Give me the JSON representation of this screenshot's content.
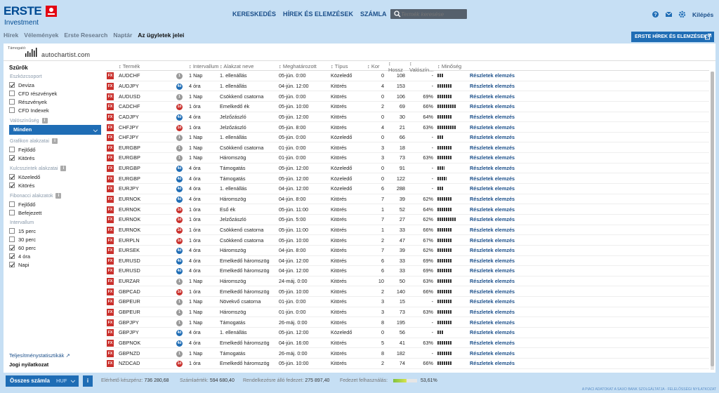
{
  "header": {
    "brand": "ERSTE",
    "sub": "Investment",
    "nav": [
      "KERESKEDÉS",
      "HÍREK ÉS ELEMZÉSEK",
      "SZÁMLA"
    ],
    "search_placeholder": "Termék keresése",
    "logout": "Kilépés"
  },
  "subnav": {
    "items": [
      "Hírek",
      "Vélemények",
      "Erste Research",
      "Naptár",
      "Az ügyletek jelei"
    ],
    "active": 4,
    "button": "ERSTE HÍREK ÉS ELEMZÉSEK"
  },
  "sponsor": {
    "label": "Támogató:",
    "name": "autochartist.com"
  },
  "filters": {
    "title": "Szűrők",
    "g1": "Eszközcsoport",
    "g1items": [
      {
        "l": "Deviza",
        "c": true
      },
      {
        "l": "CFD részvények",
        "c": false
      },
      {
        "l": "Részvények",
        "c": false
      },
      {
        "l": "CFD Indexek",
        "c": false
      }
    ],
    "g2": "Valószínűség",
    "select": "Minden",
    "g3": "Grafikon alakzatai",
    "g3items": [
      {
        "l": "Fejlődő",
        "c": false
      },
      {
        "l": "Kitörés",
        "c": true
      }
    ],
    "g4": "Kulcsszintek alakzatai",
    "g4items": [
      {
        "l": "Közeledő",
        "c": true
      },
      {
        "l": "Kitörés",
        "c": true
      }
    ],
    "g5": "Fibonacci alakzatok",
    "g5items": [
      {
        "l": "Fejlődő",
        "c": false
      },
      {
        "l": "Befejezett",
        "c": false
      }
    ],
    "g6": "Intervallum",
    "g6items": [
      {
        "l": "15 perc",
        "c": false
      },
      {
        "l": "30 perc",
        "c": false
      },
      {
        "l": "60 perc",
        "c": true
      },
      {
        "l": "4 óra",
        "c": true
      },
      {
        "l": "Napi",
        "c": true
      }
    ],
    "link1": "Teljesítménystatisztikák",
    "link2": "Jogi nyilatkozat"
  },
  "table": {
    "columns": [
      "Termék",
      "Intervallum",
      "Alakzat neve",
      "Meghatározott",
      "Típus",
      "Kor",
      "Hossz",
      "Valószín...",
      "Minőség",
      ""
    ],
    "link": "Részletek elemzés",
    "rows": [
      [
        "AUDCHF",
        "1 Nap",
        "1. ellenállás",
        "05-jún. 0:00",
        "Közeledő",
        "0",
        "108",
        "-",
        3
      ],
      [
        "AUDJPY",
        "4 óra",
        "1. ellenállás",
        "04-jún. 12:00",
        "Kitörés",
        "4",
        "153",
        "-",
        8
      ],
      [
        "AUDUSD",
        "1 Nap",
        "Csökkenő csatorna",
        "05-jún. 0:00",
        "Kitörés",
        "0",
        "106",
        "69%",
        8
      ],
      [
        "CADCHF",
        "1 óra",
        "Emelkedő ék",
        "05-jún. 10:00",
        "Kitörés",
        "2",
        "69",
        "66%",
        10
      ],
      [
        "CADJPY",
        "4 óra",
        "Jelzőzászló",
        "05-jún. 12:00",
        "Kitörés",
        "0",
        "30",
        "64%",
        8
      ],
      [
        "CHFJPY",
        "1 óra",
        "Jelzőzászló",
        "05-jún. 8:00",
        "Kitörés",
        "4",
        "21",
        "63%",
        10
      ],
      [
        "CHFJPY",
        "1 Nap",
        "1. ellenállás",
        "05-jún. 0:00",
        "Közeledő",
        "0",
        "66",
        "-",
        3
      ],
      [
        "EURGBP",
        "1 Nap",
        "Csökkenő csatorna",
        "01-jún. 0:00",
        "Kitörés",
        "3",
        "18",
        "-",
        8
      ],
      [
        "EURGBP",
        "1 Nap",
        "Háromszög",
        "01-jún. 0:00",
        "Kitörés",
        "3",
        "73",
        "63%",
        8
      ],
      [
        "EURGBP",
        "4 óra",
        "Támogatás",
        "05-jún. 12:00",
        "Közeledő",
        "0",
        "91",
        "-",
        4
      ],
      [
        "EURGBP",
        "4 óra",
        "Támogatás",
        "05-jún. 12:00",
        "Közeledő",
        "0",
        "122",
        "-",
        5
      ],
      [
        "EURJPY",
        "4 óra",
        "1. ellenállás",
        "04-jún. 12:00",
        "Közeledő",
        "6",
        "288",
        "-",
        3
      ],
      [
        "EURNOK",
        "4 óra",
        "Háromszög",
        "04-jún. 8:00",
        "Kitörés",
        "7",
        "39",
        "62%",
        8
      ],
      [
        "EURNOK",
        "1 óra",
        "Eső ék",
        "05-jún. 11:00",
        "Kitörés",
        "1",
        "52",
        "64%",
        8
      ],
      [
        "EURNOK",
        "1 óra",
        "Jelzőzászló",
        "05-jún. 5:00",
        "Kitörés",
        "7",
        "27",
        "62%",
        10
      ],
      [
        "EURNOK",
        "1 óra",
        "Csökkenő csatorna",
        "05-jún. 11:00",
        "Kitörés",
        "1",
        "33",
        "66%",
        8
      ],
      [
        "EURPLN",
        "1 óra",
        "Csökkenő csatorna",
        "05-jún. 10:00",
        "Kitörés",
        "2",
        "47",
        "67%",
        8
      ],
      [
        "EURSEK",
        "4 óra",
        "Háromszög",
        "04-jún. 8:00",
        "Kitörés",
        "7",
        "39",
        "62%",
        8
      ],
      [
        "EURUSD",
        "4 óra",
        "Emelkedő háromszög",
        "04-jún. 12:00",
        "Kitörés",
        "6",
        "33",
        "69%",
        8
      ],
      [
        "EURUSD",
        "4 óra",
        "Emelkedő háromszög",
        "04-jún. 12:00",
        "Kitörés",
        "6",
        "33",
        "69%",
        8
      ],
      [
        "EURZAR",
        "1 Nap",
        "Háromszög",
        "24-máj. 0:00",
        "Kitörés",
        "10",
        "50",
        "63%",
        8
      ],
      [
        "GBPCAD",
        "1 óra",
        "Emelkedő háromszög",
        "05-jún. 10:00",
        "Kitörés",
        "2",
        "140",
        "66%",
        8
      ],
      [
        "GBPEUR",
        "1 Nap",
        "Növekvő csatorna",
        "01-jún. 0:00",
        "Kitörés",
        "3",
        "15",
        "-",
        8
      ],
      [
        "GBPEUR",
        "1 Nap",
        "Háromszög",
        "01-jún. 0:00",
        "Kitörés",
        "3",
        "73",
        "63%",
        8
      ],
      [
        "GBPJPY",
        "1 Nap",
        "Támogatás",
        "26-máj. 0:00",
        "Kitörés",
        "8",
        "195",
        "-",
        8
      ],
      [
        "GBPJPY",
        "4 óra",
        "1. ellenállás",
        "05-jún. 12:00",
        "Közeledő",
        "0",
        "56",
        "-",
        3
      ],
      [
        "GBPNOK",
        "4 óra",
        "Emelkedő háromszög",
        "04-jún. 16:00",
        "Kitörés",
        "5",
        "41",
        "63%",
        8
      ],
      [
        "GBPNZD",
        "1 Nap",
        "Támogatás",
        "26-máj. 0:00",
        "Kitörés",
        "8",
        "182",
        "-",
        8
      ],
      [
        "NZDCAD",
        "1 óra",
        "Emelkedő háromszög",
        "05-jún. 10:00",
        "Kitörés",
        "2",
        "74",
        "66%",
        8
      ]
    ]
  },
  "footer": {
    "account": "Összes számla",
    "currency": "HUF",
    "f1l": "Elérhető készpénz:",
    "f1v": "736 280,68",
    "f2l": "Számlaérték:",
    "f2v": "594 680,40",
    "f3l": "Rendelkezésre álló fedezet:",
    "f3v": "275 897,40",
    "f4l": "Fedezet felhasználás:",
    "f4v": "53,61%",
    "disclaimer": "A PIACI ADATOKAT A SAXO BANK SZOLGÁLTATJA - FELELŐSSÉGI NYILATKOZAT"
  },
  "colors": {
    "primary": "#1f6db5",
    "fx": "#c9302c",
    "bg": "#c6dff4"
  }
}
